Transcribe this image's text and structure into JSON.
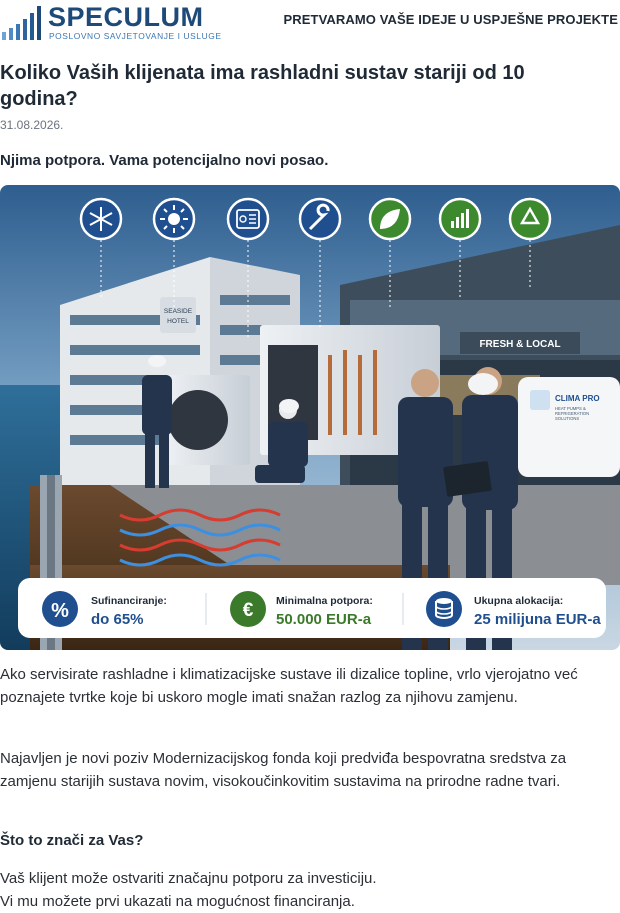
{
  "brand": {
    "name": "SPECULUM",
    "subtitle": "POSLOVNO SAVJETOVANJE I USLUGE",
    "primary_color": "#1e4a7a",
    "accent_color": "#3b77b3"
  },
  "header": {
    "tagline": "PRETVARAMO VAŠE IDEJE U USPJEŠNE PROJEKTE"
  },
  "article": {
    "title": "Koliko Vaših klijenata ima rashladni sustav stariji od 10 godina?",
    "date": "31.08.2026.",
    "lead": "Njima potpora. Vama potencijalno novi posao.",
    "paragraphs": [
      "Ako servisirate rashladne i klimatizacijske sustave ili dizalice topline, vrlo vjerojatno već poznajete tvrtke koje bi uskoro mogle imati snažan razlog za njihovu zamjenu.",
      "Najavljen je novi poziv Modernizacijskog fonda koji predviđa bespovratna sredstva za zamjenu starijih sustava novim, visokoučinkovitim sustavima na prirodne radne tvari."
    ],
    "subheading": "Što to znači za Vas?",
    "body_lines": [
      "Vaš klijent može ostvariti značajnu potporu za investiciju.",
      "Vi mu možete prvi ukazati na mogućnost financiranja."
    ]
  },
  "hero": {
    "icons": [
      "snowflake-icon",
      "sun-icon",
      "control-panel-icon",
      "wrench-icon",
      "leaf-icon",
      "growth-chart-icon",
      "recycle-icon"
    ],
    "hotel_sign": [
      "SEASIDE",
      "HOTEL"
    ],
    "store_sign": "FRESH & LOCAL",
    "van_brand": "CLIMA PRO",
    "van_tagline": [
      "HEAT PUMPS &",
      "REFRIGERATION",
      "SOLUTIONS"
    ],
    "stats": [
      {
        "icon": "percent-icon",
        "label": "Sufinanciranje:",
        "value": "do 65%",
        "color": "#1f4f8f"
      },
      {
        "icon": "euro-icon",
        "label": "Minimalna potpora:",
        "value": "50.000 EUR-a",
        "color": "#3a7a2a"
      },
      {
        "icon": "coins-icon",
        "label": "Ukupna alokacija:",
        "value": "25 milijuna EUR-a",
        "color": "#1f4f8f"
      }
    ]
  }
}
